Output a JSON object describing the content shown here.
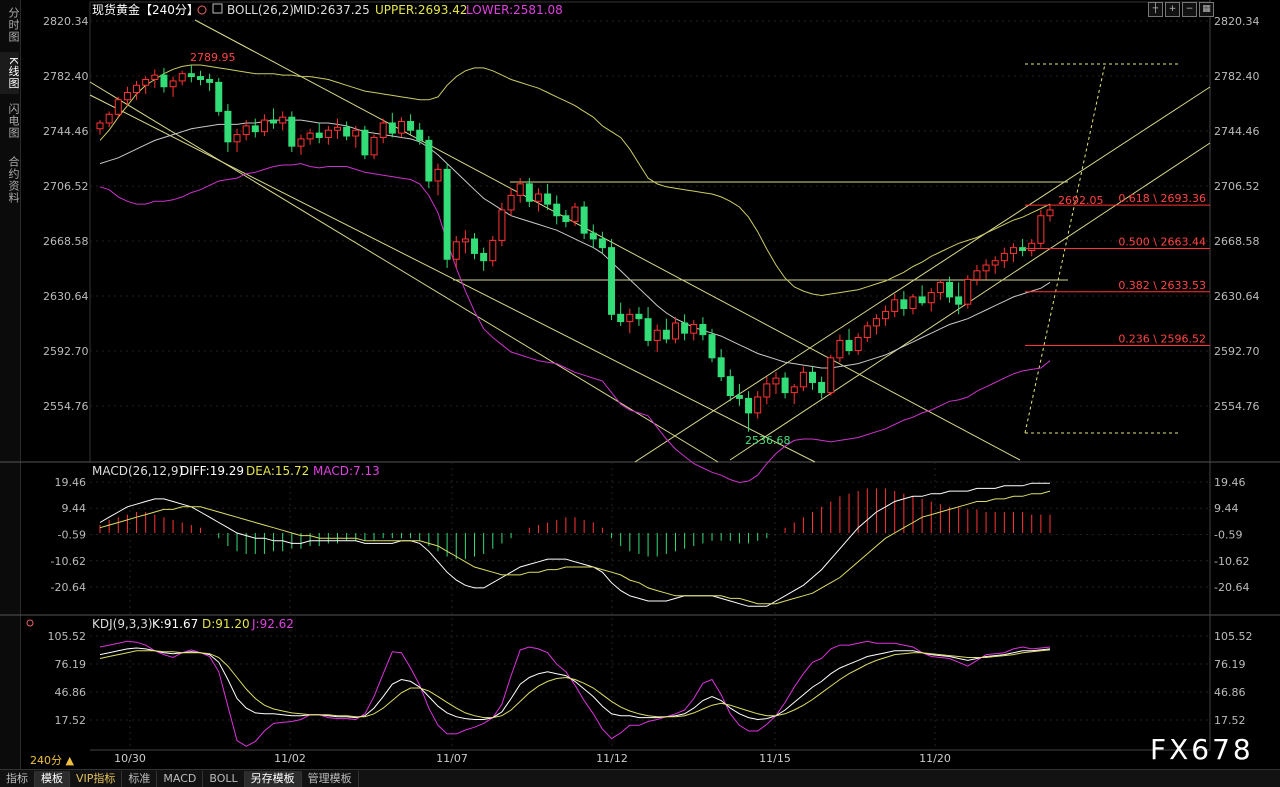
{
  "left_tabs": [
    "分时图",
    "K线图",
    "闪电图",
    "合约资料"
  ],
  "active_left_tab": 1,
  "main_panel": {
    "title": "现货黄金【240分】",
    "boll_label": "BOLL(26,2)",
    "mid": "MID:2637.25",
    "upper": "UPPER:2693.42",
    "lower": "LOWER:2581.08",
    "y_ticks": [
      "2820.34",
      "2782.40",
      "2744.46",
      "2706.52",
      "2668.58",
      "2630.64",
      "2592.70",
      "2554.76"
    ],
    "high_label": "2789.95",
    "low_label": "2536.68",
    "last_label": "2692.05",
    "fib_levels": [
      {
        "label": "0.618 \\ 2693.36",
        "value": 2693.36
      },
      {
        "label": "0.500 \\ 2663.44",
        "value": 2663.44
      },
      {
        "label": "0.382 \\ 2633.53",
        "value": 2633.53
      },
      {
        "label": "0.236 \\ 2596.52",
        "value": 2596.52
      }
    ]
  },
  "macd_panel": {
    "title": "MACD(26,12,9)",
    "diff": "DIFF:19.29",
    "dea": "DEA:15.72",
    "macd": "MACD:7.13",
    "y_ticks": [
      "19.46",
      "9.44",
      "-0.59",
      "-10.62",
      "-20.64"
    ]
  },
  "kdj_panel": {
    "title": "KDJ(9,3,3)",
    "k": "K:91.67",
    "d": "D:91.20",
    "j": "J:92.62",
    "y_ticks": [
      "105.52",
      "76.19",
      "46.86",
      "17.52"
    ]
  },
  "x_labels": [
    "10/30",
    "11/02",
    "11/07",
    "11/12",
    "11/15",
    "11/20"
  ],
  "period": "240分 ▲",
  "bottom_tabs": [
    "指标",
    "模板",
    "VIP指标",
    "标准",
    "MACD",
    "BOLL",
    "另存模板",
    "管理模板"
  ],
  "active_bottom_tab": 1,
  "watermark": "FX678",
  "colors": {
    "up": "#ff3333",
    "down": "#33dd77",
    "mid": "#c9c9c9",
    "upper": "#cccc66",
    "lower": "#cc33cc",
    "macd_diff": "#ffffff",
    "macd_dea": "#dddd66",
    "kdj_k": "#ffffff",
    "kdj_d": "#dddd66",
    "kdj_j": "#dd33dd"
  },
  "chart_data": {
    "type": "candlestick",
    "candles": [
      [
        2746,
        2752,
        2742,
        2750
      ],
      [
        2750,
        2758,
        2747,
        2756
      ],
      [
        2756,
        2768,
        2754,
        2766
      ],
      [
        2766,
        2775,
        2762,
        2771
      ],
      [
        2771,
        2779,
        2766,
        2776
      ],
      [
        2776,
        2782,
        2770,
        2780
      ],
      [
        2780,
        2787,
        2774,
        2783
      ],
      [
        2783,
        2788,
        2771,
        2775
      ],
      [
        2775,
        2782,
        2768,
        2779
      ],
      [
        2779,
        2786,
        2776,
        2784
      ],
      [
        2784,
        2790,
        2778,
        2782
      ],
      [
        2782,
        2786,
        2776,
        2780
      ],
      [
        2780,
        2784,
        2772,
        2778
      ],
      [
        2778,
        2781,
        2755,
        2758
      ],
      [
        2758,
        2763,
        2730,
        2737
      ],
      [
        2737,
        2746,
        2730,
        2742
      ],
      [
        2742,
        2752,
        2738,
        2748
      ],
      [
        2748,
        2753,
        2740,
        2744
      ],
      [
        2744,
        2756,
        2741,
        2752
      ],
      [
        2752,
        2760,
        2746,
        2750
      ],
      [
        2750,
        2758,
        2745,
        2754
      ],
      [
        2754,
        2758,
        2730,
        2734
      ],
      [
        2734,
        2742,
        2728,
        2739
      ],
      [
        2739,
        2746,
        2735,
        2743
      ],
      [
        2743,
        2750,
        2736,
        2740
      ],
      [
        2740,
        2748,
        2735,
        2745
      ],
      [
        2745,
        2753,
        2739,
        2747
      ],
      [
        2747,
        2751,
        2738,
        2741
      ],
      [
        2741,
        2748,
        2733,
        2745
      ],
      [
        2745,
        2748,
        2725,
        2728
      ],
      [
        2728,
        2742,
        2725,
        2740
      ],
      [
        2740,
        2753,
        2736,
        2750
      ],
      [
        2750,
        2757,
        2740,
        2743
      ],
      [
        2743,
        2754,
        2740,
        2751
      ],
      [
        2751,
        2756,
        2742,
        2745
      ],
      [
        2745,
        2750,
        2735,
        2738
      ],
      [
        2738,
        2741,
        2705,
        2710
      ],
      [
        2710,
        2722,
        2700,
        2718
      ],
      [
        2718,
        2722,
        2650,
        2656
      ],
      [
        2656,
        2672,
        2650,
        2668
      ],
      [
        2668,
        2676,
        2660,
        2670
      ],
      [
        2670,
        2674,
        2656,
        2660
      ],
      [
        2660,
        2664,
        2648,
        2655
      ],
      [
        2655,
        2672,
        2651,
        2669
      ],
      [
        2669,
        2695,
        2665,
        2690
      ],
      [
        2690,
        2705,
        2686,
        2700
      ],
      [
        2700,
        2712,
        2695,
        2708
      ],
      [
        2708,
        2712,
        2692,
        2696
      ],
      [
        2696,
        2705,
        2689,
        2701
      ],
      [
        2701,
        2708,
        2690,
        2694
      ],
      [
        2694,
        2700,
        2680,
        2686
      ],
      [
        2686,
        2690,
        2678,
        2682
      ],
      [
        2682,
        2695,
        2679,
        2692
      ],
      [
        2692,
        2696,
        2670,
        2674
      ],
      [
        2674,
        2680,
        2664,
        2670
      ],
      [
        2670,
        2675,
        2660,
        2664
      ],
      [
        2664,
        2670,
        2614,
        2618
      ],
      [
        2618,
        2626,
        2610,
        2613
      ],
      [
        2613,
        2622,
        2605,
        2618
      ],
      [
        2618,
        2623,
        2610,
        2615
      ],
      [
        2615,
        2623,
        2596,
        2600
      ],
      [
        2600,
        2611,
        2592,
        2607
      ],
      [
        2607,
        2615,
        2598,
        2601
      ],
      [
        2601,
        2616,
        2598,
        2612
      ],
      [
        2612,
        2618,
        2600,
        2605
      ],
      [
        2605,
        2614,
        2600,
        2611
      ],
      [
        2611,
        2616,
        2600,
        2604
      ],
      [
        2604,
        2608,
        2585,
        2588
      ],
      [
        2588,
        2594,
        2572,
        2575
      ],
      [
        2575,
        2580,
        2558,
        2562
      ],
      [
        2562,
        2570,
        2555,
        2560
      ],
      [
        2560,
        2565,
        2537,
        2550
      ],
      [
        2550,
        2565,
        2546,
        2561
      ],
      [
        2561,
        2575,
        2556,
        2570
      ],
      [
        2570,
        2578,
        2563,
        2574
      ],
      [
        2574,
        2578,
        2560,
        2564
      ],
      [
        2564,
        2570,
        2556,
        2568
      ],
      [
        2568,
        2582,
        2565,
        2578
      ],
      [
        2578,
        2582,
        2566,
        2571
      ],
      [
        2571,
        2575,
        2560,
        2564
      ],
      [
        2564,
        2590,
        2562,
        2588
      ],
      [
        2588,
        2604,
        2585,
        2600
      ],
      [
        2600,
        2608,
        2590,
        2593
      ],
      [
        2593,
        2605,
        2590,
        2602
      ],
      [
        2602,
        2613,
        2599,
        2610
      ],
      [
        2610,
        2618,
        2604,
        2615
      ],
      [
        2615,
        2624,
        2610,
        2620
      ],
      [
        2620,
        2632,
        2616,
        2628
      ],
      [
        2628,
        2634,
        2617,
        2622
      ],
      [
        2622,
        2632,
        2618,
        2630
      ],
      [
        2630,
        2638,
        2624,
        2626
      ],
      [
        2626,
        2636,
        2620,
        2633
      ],
      [
        2633,
        2642,
        2628,
        2640
      ],
      [
        2640,
        2644,
        2626,
        2630
      ],
      [
        2630,
        2640,
        2618,
        2625
      ],
      [
        2625,
        2645,
        2622,
        2642
      ],
      [
        2642,
        2652,
        2638,
        2648
      ],
      [
        2648,
        2656,
        2642,
        2652
      ],
      [
        2652,
        2658,
        2646,
        2655
      ],
      [
        2655,
        2664,
        2650,
        2660
      ],
      [
        2660,
        2667,
        2654,
        2664
      ],
      [
        2664,
        2670,
        2658,
        2662
      ],
      [
        2662,
        2670,
        2658,
        2667
      ],
      [
        2667,
        2690,
        2664,
        2686
      ],
      [
        2686,
        2694,
        2682,
        2690
      ]
    ],
    "boll_mid": [
      2722,
      2724,
      2726,
      2729,
      2732,
      2735,
      2738,
      2740,
      2742,
      2744,
      2746,
      2747,
      2748,
      2749,
      2749,
      2749,
      2750,
      2750,
      2751,
      2752,
      2752,
      2752,
      2752,
      2751,
      2750,
      2750,
      2749,
      2748,
      2746,
      2744,
      2743,
      2742,
      2741,
      2740,
      2739,
      2737,
      2733,
      2728,
      2722,
      2716,
      2710,
      2704,
      2698,
      2694,
      2690,
      2686,
      2684,
      2682,
      2680,
      2678,
      2676,
      2673,
      2670,
      2667,
      2664,
      2660,
      2654,
      2648,
      2642,
      2636,
      2630,
      2624,
      2619,
      2615,
      2612,
      2609,
      2607,
      2605,
      2603,
      2600,
      2597,
      2594,
      2591,
      2589,
      2587,
      2585,
      2584,
      2583,
      2582,
      2581,
      2581,
      2582,
      2583,
      2584,
      2586,
      2588,
      2590,
      2593,
      2596,
      2599,
      2602,
      2605,
      2608,
      2611,
      2613,
      2615,
      2618,
      2621,
      2624,
      2627,
      2630,
      2632,
      2634,
      2636,
      2640
    ],
    "boll_upper": [
      2738,
      2745,
      2754,
      2762,
      2770,
      2776,
      2780,
      2784,
      2787,
      2789,
      2790,
      2790,
      2789,
      2788,
      2787,
      2786,
      2785,
      2784,
      2784,
      2784,
      2783,
      2783,
      2782,
      2782,
      2781,
      2780,
      2778,
      2776,
      2774,
      2772,
      2771,
      2770,
      2769,
      2768,
      2767,
      2766,
      2766,
      2768,
      2776,
      2782,
      2786,
      2788,
      2788,
      2786,
      2783,
      2780,
      2778,
      2776,
      2774,
      2771,
      2768,
      2765,
      2762,
      2758,
      2754,
      2748,
      2744,
      2740,
      2732,
      2722,
      2712,
      2708,
      2706,
      2705,
      2704,
      2703,
      2702,
      2701,
      2699,
      2696,
      2692,
      2685,
      2675,
      2663,
      2652,
      2643,
      2637,
      2634,
      2632,
      2631,
      2632,
      2633,
      2634,
      2635,
      2637,
      2639,
      2641,
      2644,
      2647,
      2651,
      2654,
      2658,
      2661,
      2664,
      2667,
      2669,
      2671,
      2674,
      2677,
      2680,
      2683,
      2685,
      2688,
      2691,
      2694
    ],
    "boll_lower": [
      2706,
      2704,
      2699,
      2696,
      2694,
      2694,
      2696,
      2696,
      2697,
      2699,
      2702,
      2704,
      2707,
      2710,
      2711,
      2712,
      2715,
      2716,
      2718,
      2720,
      2721,
      2721,
      2722,
      2720,
      2719,
      2720,
      2720,
      2720,
      2718,
      2716,
      2715,
      2714,
      2713,
      2712,
      2711,
      2708,
      2700,
      2688,
      2668,
      2650,
      2634,
      2620,
      2608,
      2602,
      2597,
      2592,
      2590,
      2588,
      2586,
      2585,
      2584,
      2581,
      2578,
      2576,
      2574,
      2572,
      2564,
      2556,
      2552,
      2550,
      2548,
      2540,
      2532,
      2525,
      2520,
      2515,
      2512,
      2509,
      2507,
      2504,
      2502,
      2503,
      2507,
      2515,
      2522,
      2527,
      2531,
      2532,
      2532,
      2531,
      2530,
      2531,
      2532,
      2533,
      2535,
      2537,
      2539,
      2542,
      2545,
      2547,
      2550,
      2552,
      2555,
      2558,
      2559,
      2561,
      2565,
      2568,
      2571,
      2574,
      2577,
      2579,
      2580,
      2581,
      2586
    ],
    "macd_hist": [
      3,
      5,
      6,
      7,
      8,
      8,
      7,
      6,
      5,
      4,
      3,
      2,
      0,
      -2,
      -5,
      -7,
      -8,
      -8,
      -8,
      -7,
      -7,
      -6,
      -6,
      -5,
      -5,
      -4,
      -4,
      -3,
      -3,
      -3,
      -3,
      -2,
      -2,
      -2,
      -2,
      -3,
      -5,
      -7,
      -9,
      -10,
      -10,
      -9,
      -8,
      -6,
      -4,
      -2,
      0,
      2,
      3,
      4,
      5,
      6,
      6,
      5,
      4,
      2,
      -2,
      -5,
      -7,
      -8,
      -9,
      -9,
      -8,
      -7,
      -6,
      -5,
      -4,
      -3,
      -3,
      -3,
      -4,
      -4,
      -3,
      -2,
      0,
      2,
      4,
      6,
      8,
      10,
      12,
      14,
      15,
      16,
      17,
      17,
      17,
      16,
      15,
      14,
      13,
      12,
      11,
      10,
      10,
      9,
      9,
      8,
      8,
      8,
      8,
      8,
      7,
      7,
      7
    ],
    "macd_diff": [
      4,
      6,
      8,
      10,
      11,
      12,
      13,
      13,
      12,
      11,
      10,
      8,
      6,
      4,
      2,
      0,
      -1,
      -2,
      -2,
      -3,
      -3,
      -4,
      -4,
      -3,
      -3,
      -3,
      -3,
      -3,
      -3,
      -4,
      -4,
      -4,
      -4,
      -3,
      -3,
      -4,
      -7,
      -11,
      -15,
      -18,
      -20,
      -21,
      -21,
      -19,
      -17,
      -15,
      -13,
      -12,
      -11,
      -10,
      -10,
      -10,
      -11,
      -12,
      -13,
      -15,
      -19,
      -22,
      -24,
      -25,
      -26,
      -26,
      -26,
      -25,
      -24,
      -24,
      -24,
      -24,
      -25,
      -26,
      -27,
      -28,
      -28,
      -28,
      -26,
      -24,
      -22,
      -20,
      -17,
      -14,
      -10,
      -6,
      -2,
      2,
      5,
      8,
      10,
      12,
      13,
      14,
      14,
      15,
      15,
      16,
      16,
      16,
      17,
      17,
      17,
      18,
      18,
      18,
      19,
      19,
      19
    ],
    "macd_dea": [
      2,
      3,
      4,
      5,
      6,
      7,
      8,
      9,
      9,
      10,
      10,
      10,
      9,
      8,
      7,
      6,
      5,
      4,
      3,
      2,
      1,
      0,
      -1,
      -1,
      -2,
      -2,
      -2,
      -2,
      -2,
      -3,
      -3,
      -3,
      -3,
      -3,
      -3,
      -3,
      -4,
      -5,
      -7,
      -9,
      -11,
      -13,
      -14,
      -15,
      -16,
      -16,
      -16,
      -15,
      -15,
      -14,
      -14,
      -13,
      -13,
      -13,
      -13,
      -14,
      -15,
      -16,
      -18,
      -19,
      -21,
      -22,
      -23,
      -24,
      -24,
      -24,
      -24,
      -24,
      -24,
      -25,
      -25,
      -26,
      -27,
      -27,
      -27,
      -26,
      -25,
      -24,
      -23,
      -21,
      -19,
      -17,
      -14,
      -11,
      -8,
      -5,
      -2,
      0,
      2,
      4,
      6,
      7,
      8,
      9,
      10,
      11,
      12,
      12,
      13,
      13,
      14,
      14,
      15,
      15,
      16
    ],
    "kdj_k": [
      86,
      88,
      90,
      92,
      93,
      92,
      90,
      88,
      87,
      88,
      89,
      88,
      86,
      78,
      60,
      40,
      30,
      25,
      24,
      24,
      23,
      22,
      22,
      23,
      23,
      22,
      21,
      21,
      20,
      22,
      30,
      42,
      55,
      60,
      58,
      52,
      42,
      32,
      25,
      21,
      19,
      18,
      18,
      20,
      26,
      40,
      55,
      62,
      66,
      68,
      66,
      64,
      58,
      50,
      42,
      32,
      24,
      22,
      22,
      20,
      20,
      20,
      21,
      22,
      24,
      30,
      38,
      42,
      38,
      30,
      24,
      20,
      18,
      19,
      22,
      28,
      36,
      44,
      52,
      58,
      66,
      72,
      76,
      80,
      84,
      86,
      88,
      90,
      90,
      90,
      88,
      86,
      85,
      84,
      82,
      80,
      82,
      84,
      85,
      86,
      88,
      90,
      90,
      91,
      92
    ],
    "kdj_d": [
      82,
      84,
      86,
      88,
      90,
      90,
      90,
      89,
      89,
      88,
      88,
      88,
      87,
      83,
      74,
      62,
      50,
      40,
      33,
      29,
      27,
      25,
      24,
      23,
      23,
      23,
      22,
      22,
      21,
      21,
      24,
      30,
      38,
      46,
      51,
      51,
      48,
      42,
      36,
      30,
      25,
      22,
      20,
      20,
      22,
      28,
      37,
      46,
      53,
      58,
      61,
      62,
      60,
      56,
      51,
      44,
      37,
      31,
      27,
      24,
      22,
      21,
      21,
      21,
      22,
      25,
      29,
      33,
      35,
      33,
      30,
      27,
      24,
      22,
      22,
      24,
      28,
      33,
      39,
      46,
      53,
      60,
      66,
      71,
      76,
      80,
      83,
      86,
      87,
      88,
      88,
      87,
      86,
      85,
      84,
      83,
      83,
      83,
      84,
      85,
      86,
      88,
      89,
      90,
      91
    ],
    "kdj_j": [
      94,
      96,
      98,
      100,
      99,
      96,
      90,
      86,
      83,
      88,
      91,
      88,
      84,
      68,
      32,
      -4,
      -10,
      -5,
      6,
      14,
      15,
      16,
      18,
      23,
      23,
      20,
      19,
      19,
      18,
      24,
      42,
      66,
      89,
      88,
      72,
      54,
      30,
      12,
      3,
      3,
      7,
      10,
      14,
      20,
      34,
      64,
      91,
      94,
      92,
      88,
      76,
      68,
      54,
      38,
      24,
      8,
      -2,
      4,
      12,
      12,
      16,
      18,
      21,
      24,
      28,
      40,
      56,
      60,
      44,
      24,
      12,
      6,
      6,
      13,
      22,
      36,
      52,
      66,
      78,
      82,
      92,
      96,
      96,
      98,
      100,
      98,
      98,
      98,
      96,
      94,
      88,
      84,
      83,
      82,
      78,
      74,
      80,
      86,
      87,
      88,
      92,
      94,
      92,
      93,
      94
    ]
  }
}
